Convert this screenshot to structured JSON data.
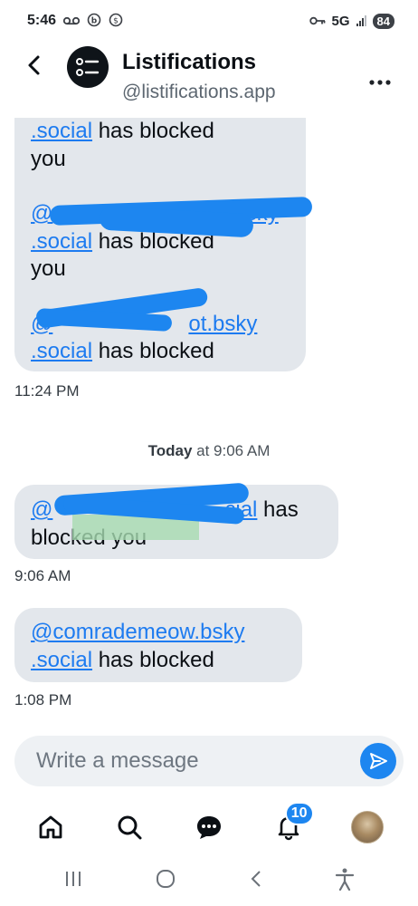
{
  "status_bar": {
    "time": "5:46",
    "network": "5G",
    "battery": "84"
  },
  "header": {
    "title": "Listifications",
    "handle": "@listifications.app"
  },
  "messages": {
    "top_bubble": {
      "line1_mention": ".social",
      "line1_text": " has blocked",
      "line2": "you",
      "line3_mention": "@",
      "line3_tail": "bsky",
      "line4_mention": ".social",
      "line4_text": " has blocked",
      "line5": "you",
      "line6_mention": "@",
      "line6_tail": "ot.bsky",
      "line7_mention": ".social",
      "line7_text": " has blocked"
    },
    "top_time": "11:24 PM",
    "day_separator": {
      "day": "Today",
      "rest": " at 9:06 AM"
    },
    "bubble2": {
      "line1_mention_start": "@",
      "line1_mention_end": "cial",
      "line1_text": " has",
      "line2": "blocked you"
    },
    "bubble2_time": "9:06 AM",
    "bubble3": {
      "line1_mention": "@comrademeow.bsky",
      "line2_mention": ".social",
      "line2_text": " has blocked"
    },
    "bubble3_time": "1:08 PM"
  },
  "composer": {
    "placeholder": "Write a message"
  },
  "nav": {
    "notifications_badge": "10"
  },
  "icons": {
    "back": "back-arrow-icon",
    "more": "more-dots-icon",
    "send": "send-icon",
    "home": "home-icon",
    "search": "search-icon",
    "chat": "chat-icon",
    "bell": "bell-icon"
  },
  "colors": {
    "accent": "#1d86f0",
    "bubble": "#e3e7ec",
    "mention": "#1d7bf0"
  }
}
